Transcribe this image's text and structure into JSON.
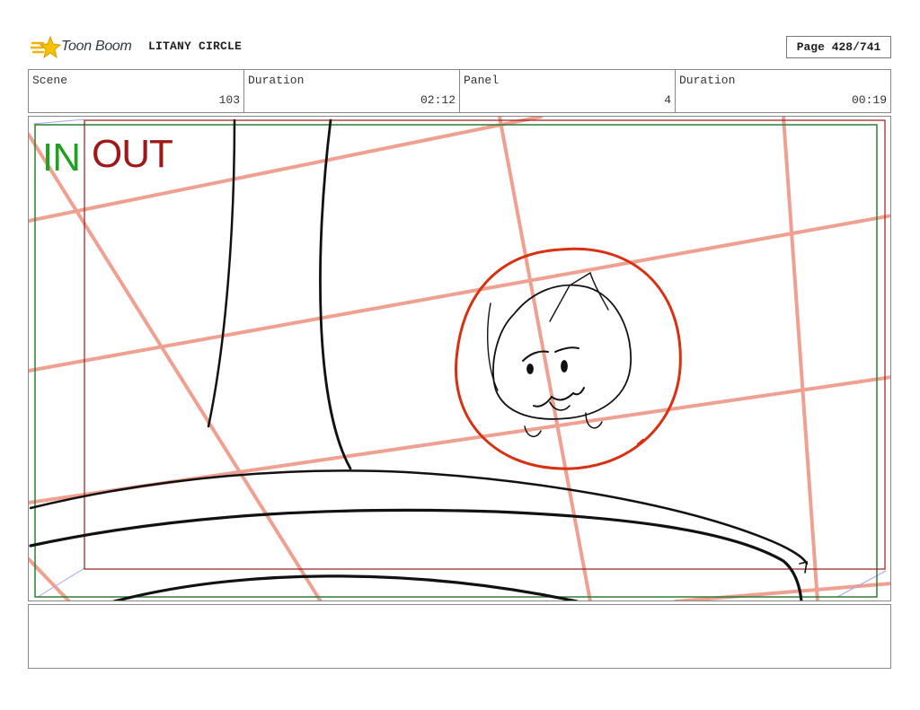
{
  "header": {
    "logo_text": "Toon Boom",
    "project_title": "LITANY CIRCLE",
    "page": "Page 428/741"
  },
  "info": [
    {
      "label": "Scene",
      "value": "103"
    },
    {
      "label": "Duration",
      "value": "02:12"
    },
    {
      "label": "Panel",
      "value": "4"
    },
    {
      "label": "Duration",
      "value": "00:19"
    }
  ],
  "panel": {
    "in_label": "IN",
    "out_label": "OUT",
    "colors": {
      "in_frame": "#2e7d32",
      "out_frame": "#a01818",
      "perspective_grid": "#f0a090",
      "focus_circle": "#d83010",
      "sketch": "#111111"
    }
  },
  "notes": ""
}
